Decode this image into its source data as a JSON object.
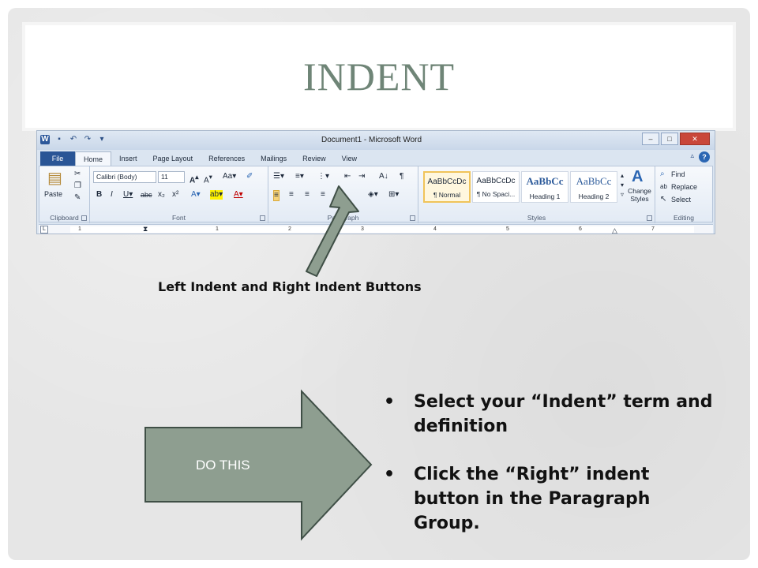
{
  "slide": {
    "title": "INDENT",
    "callout_label": "Left Indent and Right Indent Buttons",
    "arrow_label": "DO THIS",
    "bullets": [
      "Select your “Indent” term and definition",
      "Click the “Right” indent button in the Paragraph Group."
    ],
    "colors": {
      "title": "#6f8577",
      "arrow_fill": "#8e9e90",
      "arrow_stroke": "#3f4f46",
      "background": "#e6e6e6"
    }
  },
  "word": {
    "window_title": "Document1  -  Microsoft Word",
    "tabs": {
      "file": "File",
      "home": "Home",
      "insert": "Insert",
      "page_layout": "Page Layout",
      "references": "References",
      "mailings": "Mailings",
      "review": "Review",
      "view": "View"
    },
    "groups": {
      "clipboard": "Clipboard",
      "font": "Font",
      "paragraph": "Paragraph",
      "styles": "Styles",
      "editing": "Editing"
    },
    "clipboard": {
      "paste": "Paste"
    },
    "font": {
      "name": "Calibri (Body)",
      "size": "11"
    },
    "styles": [
      {
        "sample": "AaBbCcDc",
        "name": "¶ Normal"
      },
      {
        "sample": "AaBbCcDc",
        "name": "¶ No Spaci..."
      },
      {
        "sample": "AaBbCc",
        "name": "Heading 1"
      },
      {
        "sample": "AaBbCc",
        "name": "Heading 2"
      }
    ],
    "change_styles": "Change Styles",
    "editing": {
      "find": "Find",
      "replace": "Replace",
      "select": "Select"
    },
    "ruler_numbers": [
      "1",
      "1",
      "2",
      "3",
      "4",
      "5",
      "6",
      "7"
    ]
  }
}
